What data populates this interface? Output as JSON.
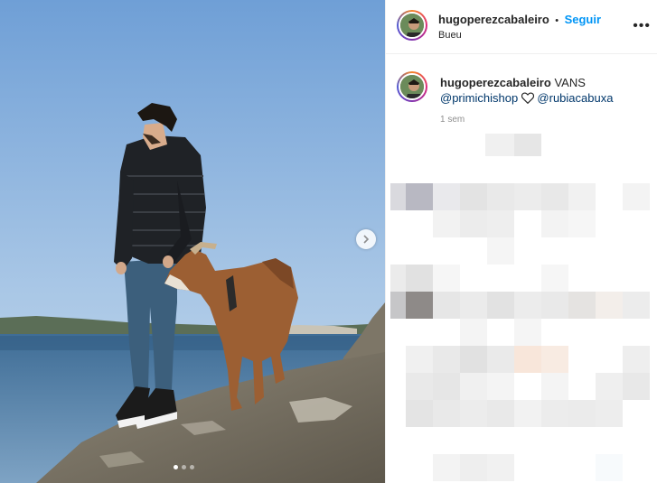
{
  "post": {
    "username": "hugoperezcabaleiro",
    "follow_separator": "•",
    "follow_label": "Seguir",
    "location": "Bueu",
    "caption_text": "VANS",
    "mentions": [
      "@primichishop",
      "@rubiacabuxa"
    ],
    "heart_icon": "heart-outline-icon",
    "timestamp": "1 sem",
    "more_icon": "more-options-icon",
    "carousel": {
      "current_slide": 1,
      "slide_count": 3,
      "next_icon": "chevron-right-icon"
    }
  },
  "colors": {
    "accent": "#0095f6",
    "mention": "#00376b",
    "muted": "#8e8e8e",
    "border": "#efefef"
  }
}
